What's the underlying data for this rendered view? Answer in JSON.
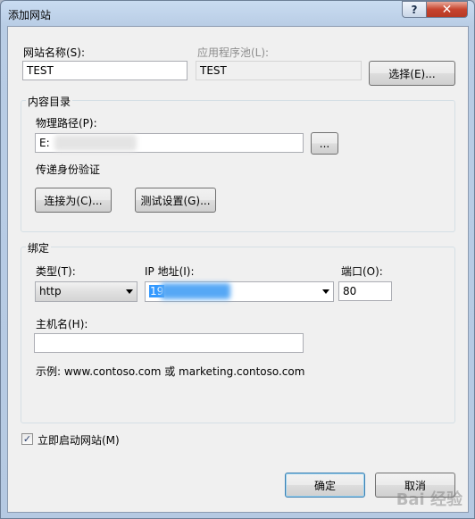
{
  "window": {
    "title": "添加网站",
    "help_glyph": "?",
    "close_glyph": "✕"
  },
  "site": {
    "name_label": "网站名称(S):",
    "name_value": "TEST",
    "pool_label": "应用程序池(L):",
    "pool_value": "TEST",
    "select_button": "选择(E)..."
  },
  "content": {
    "group_title": "内容目录",
    "path_label": "物理路径(P):",
    "path_value": "E:",
    "browse_button": "...",
    "auth_label": "传递身份验证",
    "connect_as_button": "连接为(C)...",
    "test_settings_button": "测试设置(G)..."
  },
  "binding": {
    "group_title": "绑定",
    "type_label": "类型(T):",
    "type_value": "http",
    "ip_label": "IP 地址(I):",
    "ip_value": "19",
    "port_label": "端口(O):",
    "port_value": "80",
    "hostname_label": "主机名(H):",
    "hostname_value": "",
    "example_text": "示例: www.contoso.com 或 marketing.contoso.com"
  },
  "start": {
    "checkbox_label": "立即启动网站(M)",
    "checked": true,
    "check_glyph": "✓"
  },
  "footer": {
    "ok_button": "确定",
    "cancel_button": "取消"
  },
  "watermark": "Bai 经验"
}
